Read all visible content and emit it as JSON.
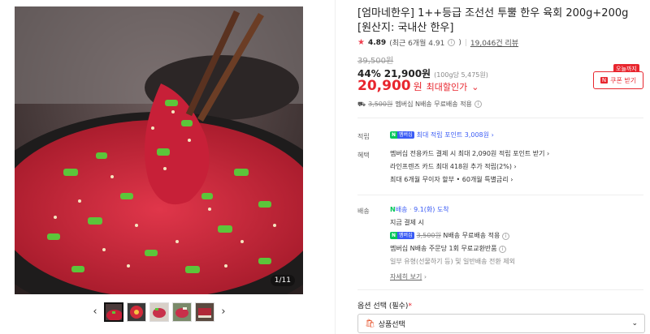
{
  "gallery": {
    "counter": "1/11",
    "thumb_count": 5,
    "prev_icon": "chevron-left-icon",
    "next_icon": "chevron-right-icon"
  },
  "product": {
    "title": "[엄마네한우] 1++등급 조선선 투뿔 한우 육회 200g+200g [원산지: 국내산 한우]",
    "rating_score": "4.89",
    "rating_recent": "(최근 6개월 4.91",
    "review_count": "19,046건 리뷰",
    "original_price": "39,500원",
    "discount_rate": "44%",
    "sale_price": "21,900원",
    "unit_price": "(100g당 5,475원)",
    "best_price": "20,900",
    "best_price_unit": "원",
    "best_price_label": "최대할인가",
    "coupon_tag": "오늘까지",
    "coupon_button": "쿠폰 받기",
    "ship_original": "3,500원",
    "ship_text": "멤버십 N배송 무료배송 적용"
  },
  "benefits": {
    "points_label": "적립",
    "points_text": "최대 적립 포인트 3,008원",
    "perks_label": "혜택",
    "perks": [
      "멤버십 전용카드 결제 시 최대 2,090원 적립 포인트 받기",
      "라인프렌즈 카드 최대 418원 추가 적립(2%)",
      "최대 6개월 무이자 할부 • 60개월 특별금리"
    ]
  },
  "delivery": {
    "label": "배송",
    "badge": "N",
    "type": "배송",
    "arrival": "9.1(화) 도착",
    "pay_now": "지금 결제 시",
    "ship_original": "3,500원",
    "ship_text": "N배송 무료배송 적용",
    "exchange": "멤버십 N배송 주문당 1회 무료교환반품",
    "note": "일부 유형(선물하기 등) 및 일반배송 전환 제외",
    "more": "자세히 보기"
  },
  "options": {
    "label": "옵션 선택 (필수)",
    "required_mark": "*",
    "select_text": "상품선택"
  },
  "badge": {
    "n": "N",
    "membership": "멤버십"
  },
  "colors": {
    "accent_red": "#e8262e",
    "naver_green": "#03c75a",
    "membership_blue": "#3b5cf5"
  }
}
